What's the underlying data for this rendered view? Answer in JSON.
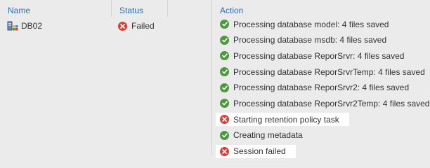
{
  "columns": {
    "name": "Name",
    "status": "Status",
    "action": "Action"
  },
  "server": {
    "name": "DB02",
    "icon": "server-icon",
    "status_label": "Failed",
    "status_icon": "error-icon"
  },
  "colors": {
    "header_text": "#2c6fb3",
    "success": "#4b9a3c",
    "error": "#d9403a",
    "background": "#ebebeb"
  },
  "actions": [
    {
      "text": "Processing database model: 4 files saved",
      "status": "success",
      "icon": "success-check-icon"
    },
    {
      "text": "Processing database msdb: 4 files saved",
      "status": "success",
      "icon": "success-check-icon"
    },
    {
      "text": "Processing database ReporSrvr: 4 files saved",
      "status": "success",
      "icon": "success-check-icon"
    },
    {
      "text": "Processing database ReporSrvrTemp: 4 files saved",
      "status": "success",
      "icon": "success-check-icon"
    },
    {
      "text": "Processing database ReporSrvr2: 4 files saved",
      "status": "success",
      "icon": "success-check-icon"
    },
    {
      "text": "Processing database ReporSrvr2Temp: 4 files saved",
      "status": "success",
      "icon": "success-check-icon"
    },
    {
      "text": "Starting retention policy task",
      "status": "error",
      "icon": "error-icon"
    },
    {
      "text": "Creating metadata",
      "status": "success",
      "icon": "success-check-icon"
    },
    {
      "text": "Session failed",
      "status": "error",
      "icon": "error-icon"
    }
  ]
}
